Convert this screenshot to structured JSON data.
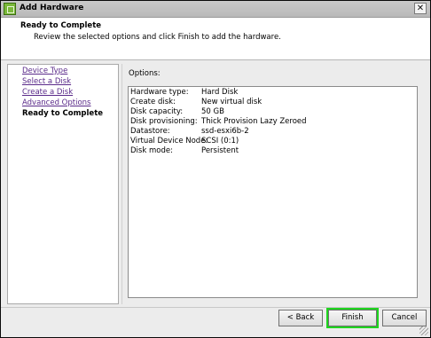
{
  "window": {
    "title": "Add Hardware",
    "close_glyph": "✕"
  },
  "header": {
    "title": "Ready to Complete",
    "subtitle": "Review the selected options and click Finish to add the hardware."
  },
  "steps": [
    {
      "label": "Device Type",
      "state": "link"
    },
    {
      "label": "Select a Disk",
      "state": "link"
    },
    {
      "label": "Create a Disk",
      "state": "link"
    },
    {
      "label": "Advanced Options",
      "state": "link"
    },
    {
      "label": "Ready to Complete",
      "state": "current"
    }
  ],
  "options": {
    "label": "Options:",
    "rows": [
      {
        "key": "Hardware type:",
        "value": "Hard Disk"
      },
      {
        "key": "Create disk:",
        "value": "New virtual disk"
      },
      {
        "key": "Disk capacity:",
        "value": "50 GB"
      },
      {
        "key": "Disk provisioning:",
        "value": "Thick Provision Lazy Zeroed"
      },
      {
        "key": "Datastore:",
        "value": "ssd-esxi6b-2"
      },
      {
        "key": "Virtual Device Node:",
        "value": "SCSI (0:1)"
      },
      {
        "key": "Disk mode:",
        "value": "Persistent"
      }
    ]
  },
  "buttons": {
    "back": "< Back",
    "finish": "Finish",
    "cancel": "Cancel"
  },
  "colors": {
    "link": "#5a2a8a",
    "finish_highlight": "#1ed51e",
    "titlebar": "#c2c2c2"
  },
  "icons": {
    "app": "vsphere-app-icon",
    "close": "close-icon",
    "resize": "resize-grip-icon"
  }
}
